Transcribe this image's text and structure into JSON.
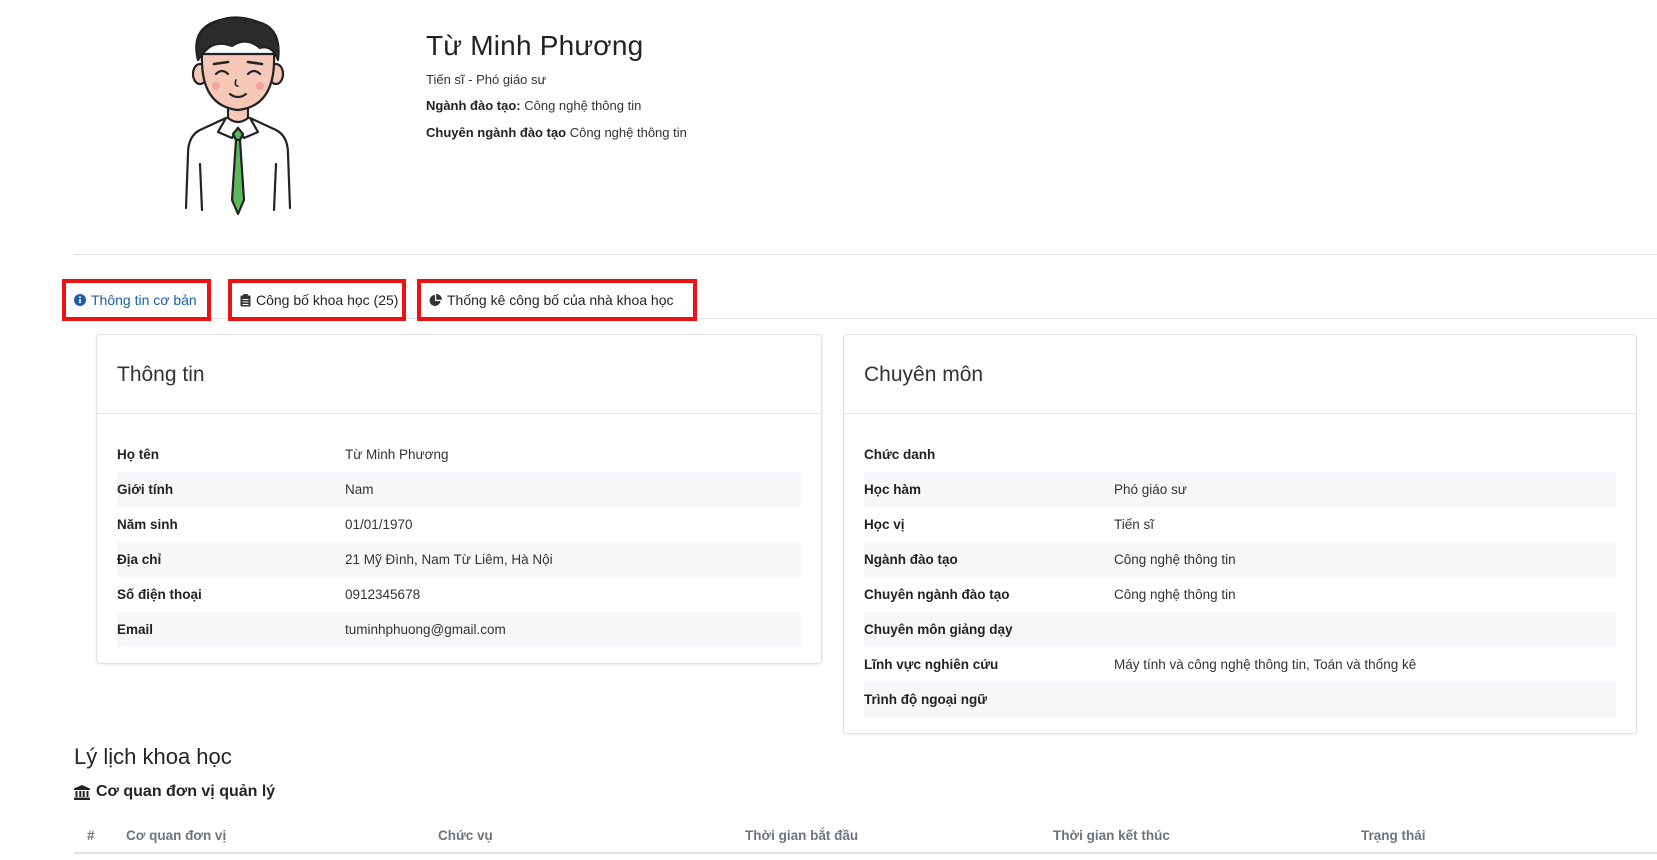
{
  "profile": {
    "name": "Từ Minh Phương",
    "degree_line": "Tiến sĩ - Phó giáo sư",
    "field_label": "Ngành đào tạo:",
    "field_value": "Công nghệ thông tin",
    "specialty_label": "Chuyên ngành đào tạo",
    "specialty_value": "Công nghệ thông tin"
  },
  "tabs": [
    {
      "label": "Thông tin cơ bản",
      "icon": "info-circle-icon"
    },
    {
      "label": "Công bố khoa học (25)",
      "icon": "clipboard-icon"
    },
    {
      "label": "Thống kê công bố của nhà khoa học",
      "icon": "pie-chart-icon"
    }
  ],
  "info_card": {
    "title": "Thông tin",
    "rows": [
      {
        "label": "Họ tên",
        "value": "Từ Minh Phương"
      },
      {
        "label": "Giới tính",
        "value": "Nam"
      },
      {
        "label": "Năm sinh",
        "value": "01/01/1970"
      },
      {
        "label": "Địa chỉ",
        "value": "21 Mỹ Đình, Nam Từ Liêm, Hà Nội"
      },
      {
        "label": "Số điện thoại",
        "value": "0912345678"
      },
      {
        "label": "Email",
        "value": "tuminhphuong@gmail.com"
      }
    ]
  },
  "expertise_card": {
    "title": "Chuyên môn",
    "rows": [
      {
        "label": "Chức danh",
        "value": ""
      },
      {
        "label": "Học hàm",
        "value": "Phó giáo sư"
      },
      {
        "label": "Học vị",
        "value": "Tiến sĩ"
      },
      {
        "label": "Ngành đào tạo",
        "value": "Công nghệ thông tin"
      },
      {
        "label": "Chuyên ngành đào tạo",
        "value": "Công nghệ thông tin"
      },
      {
        "label": "Chuyên môn giảng dạy",
        "value": ""
      },
      {
        "label": "Lĩnh vực nghiên cứu",
        "value": "Máy tính và công nghệ thông tin, Toán và thống kê"
      },
      {
        "label": "Trình độ ngoại ngữ",
        "value": ""
      }
    ]
  },
  "cv": {
    "title": "Lý lịch khoa học",
    "subtitle": "Cơ quan đơn vị quản lý",
    "subtitle_icon": "institution-icon",
    "columns": [
      "#",
      "Cơ quan đơn vị",
      "Chức vụ",
      "Thời gian bắt đầu",
      "Thời gian kết thúc",
      "Trạng thái"
    ]
  },
  "colors": {
    "tab_highlight": "#ee1111",
    "active_tab": "#1c5fa8",
    "tie": "#5cb85c"
  }
}
